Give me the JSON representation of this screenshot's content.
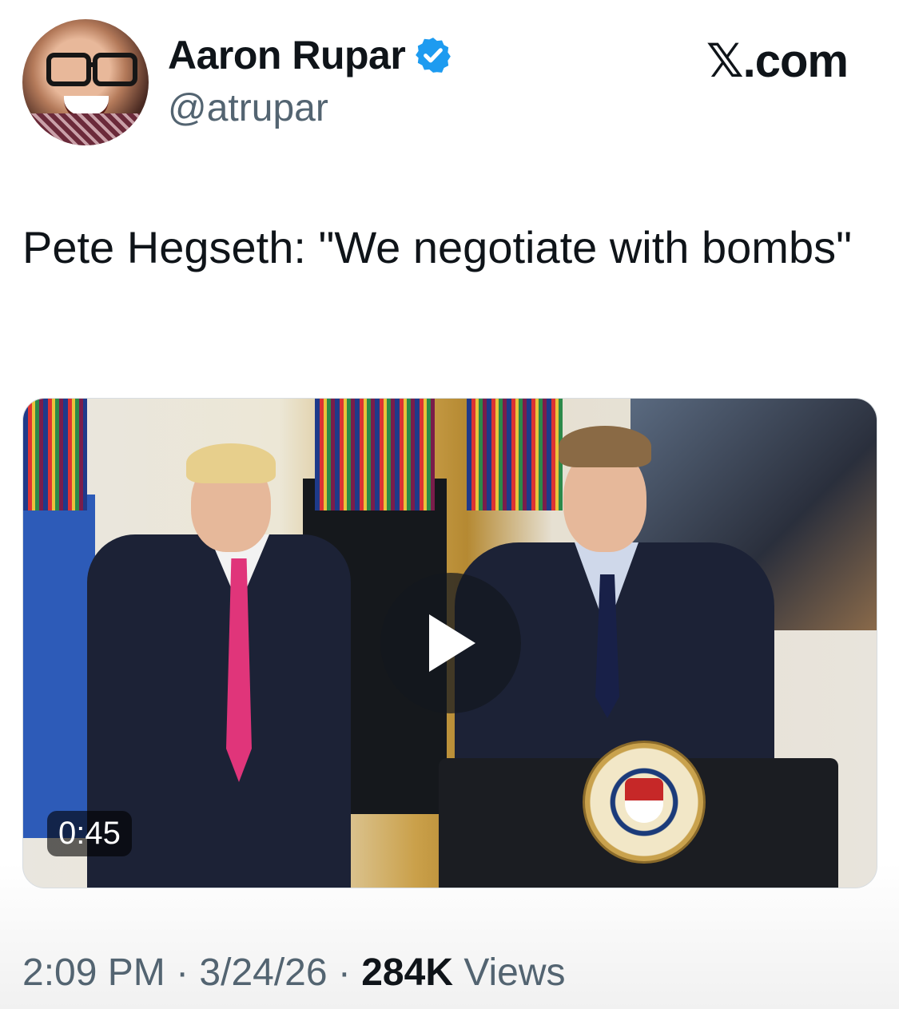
{
  "author": {
    "name": "Aaron Rupar",
    "handle": "@atrupar",
    "verified_icon": "verified-badge-icon",
    "verified_color": "#1d9bf0"
  },
  "brand": "𝕏.com",
  "tweet": {
    "text": "Pete Hegseth: \"We negotiate with bombs\""
  },
  "media": {
    "type": "video",
    "duration": "0:45",
    "play_icon": "play-icon"
  },
  "meta": {
    "time": "2:09 PM",
    "separator": " · ",
    "date": "3/24/26",
    "views_count": "284K",
    "views_label": "Views"
  }
}
